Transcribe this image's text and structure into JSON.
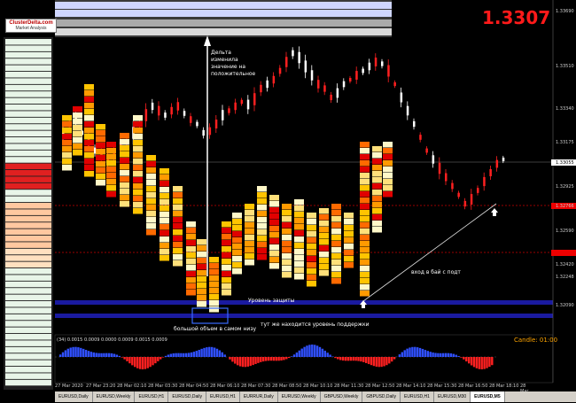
{
  "header": {
    "big_price": "1.3307",
    "logo_text": "ClusterDelta.com",
    "logo_sub": "Market Analysis"
  },
  "annotations": {
    "delta_note": [
      "Дельта",
      "изменила",
      "значение на",
      "положительное"
    ],
    "support_level": "Уровень защиты",
    "big_volume": "большой объем в самом низу",
    "support_here": "тут же находится уровень поддержки",
    "buy_entry": "вход в бай с подт"
  },
  "indicator": {
    "title": "(34) 0.0015 0.0009 0.0000 0.0009 0.0015 0.0009",
    "candle_label": "Candle: 01:00"
  },
  "price_axis": [
    "1.33690",
    "1.33510",
    "1.33340",
    "1.33175",
    "1.33000",
    "1.32925",
    "1.32766",
    "1.32590",
    "1.32420",
    "1.32248",
    "1.32090"
  ],
  "current_price_tag": "1.33055",
  "time_axis": [
    "27 Mar 2020",
    "27 Mar 23:20",
    "28 Mar 02:10",
    "28 Mar 03:30",
    "28 Mar 04:50",
    "28 Mar 06:10",
    "28 Mar 07:30",
    "28 Mar 08:50",
    "28 Mar 10:10",
    "28 Mar 11:30",
    "28 Mar 12:50",
    "28 Mar 14:10",
    "28 Mar 15:30",
    "28 Mar 16:50",
    "28 Mar 18:10",
    "28 Mar 19:30"
  ],
  "tabs": [
    "EURUSD,Daily",
    "EURUSD,Weekly",
    "EURUSD,H1",
    "EURUSD,Daily",
    "EURUSD,H1",
    "EURRUR,Daily",
    "EURUSD,Weekly",
    "GBPUSD,Weekly",
    "GBPUSD,Daily",
    "EURUSD,H1",
    "EURUSD,M30",
    "EURUSD,M5"
  ],
  "active_tab": "EURUSD,M5",
  "colors": {
    "up_candle": "#ffffff",
    "down_candle": "#ff2020",
    "band": "#1a1aa0",
    "macd_up": "#3050ff",
    "macd_down": "#ff2020"
  }
}
